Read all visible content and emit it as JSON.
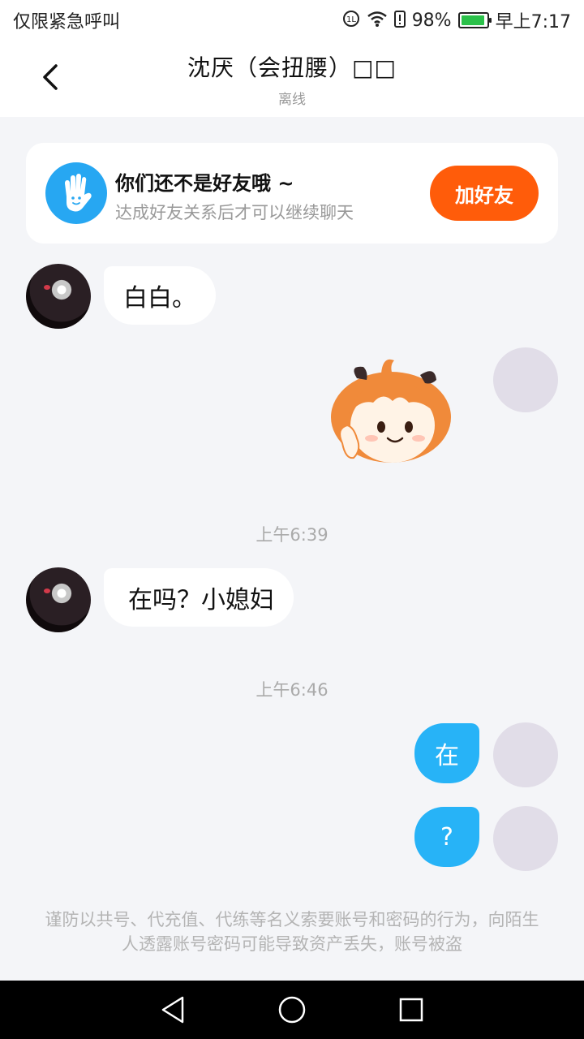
{
  "status_bar": {
    "left_text": "仅限紧急呼叫",
    "battery_percent": "98%",
    "time": "早上7:17",
    "icons": [
      "data-icon",
      "wifi-icon",
      "battery-alert-icon",
      "battery-icon"
    ]
  },
  "header": {
    "title": "沈厌（会扭腰）□□",
    "subtitle": "离线",
    "back_icon": "chevron-left-icon"
  },
  "friend_card": {
    "title": "你们还不是好友哦 ~",
    "subtitle": "达成好友关系后才可以继续聊天",
    "button_label": "加好友",
    "icon": "hand-wave-icon",
    "accent": "#ff5c0a"
  },
  "messages": {
    "m1": {
      "side": "left",
      "text": "白白。"
    },
    "m2": {
      "side": "right",
      "type": "sticker",
      "sticker_name": "orange-hair-girl-sticker"
    },
    "ts1": "上午6:39",
    "m3": {
      "side": "left",
      "text": "在吗？小媳妇"
    },
    "ts2": "上午6:46",
    "m4": {
      "side": "right",
      "text": "在"
    },
    "m5": {
      "side": "right",
      "text": "?"
    }
  },
  "disclaimer": "谨防以共号、代充值、代练等名义索要账号和密码的行为，向陌生人透露账号密码可能导致资产丢失，账号被盗",
  "nav_bar": {
    "icons": [
      "back-triangle-icon",
      "home-circle-icon",
      "recents-square-icon"
    ]
  },
  "colors": {
    "bubble_right": "#27b3f7",
    "background": "#f4f5f8"
  }
}
